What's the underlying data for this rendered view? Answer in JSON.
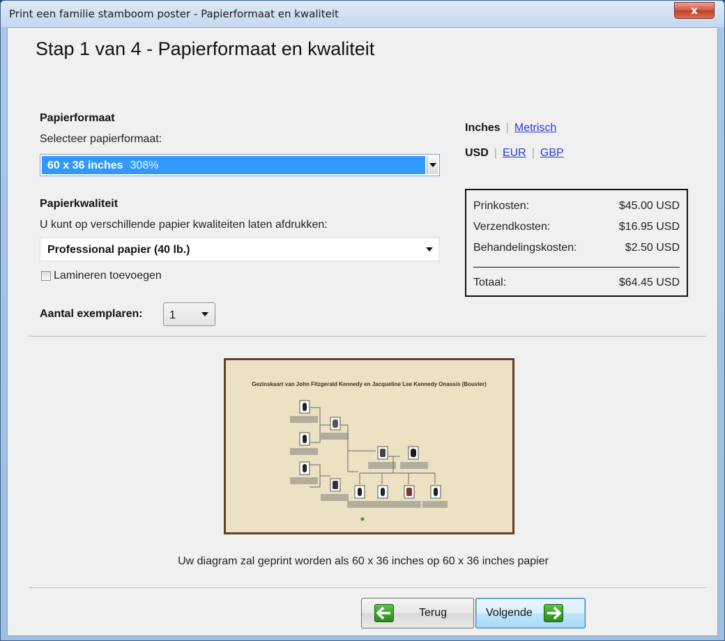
{
  "window": {
    "title": "Print een familie stamboom poster - Papierformaat en kwaliteit",
    "close_label": "x"
  },
  "step_heading": "Stap 1 van 4 - Papierformaat en kwaliteit",
  "paper_size": {
    "section_label": "Papierformaat",
    "prompt": "Selecteer papierformaat:",
    "selected_value": "60 x 36 inches",
    "selected_percent": "308%"
  },
  "paper_quality": {
    "section_label": "Papierkwaliteit",
    "prompt": "U kunt op verschillende papier kwaliteiten laten afdrukken:",
    "selected_value": "Professional papier (40 lb.)",
    "laminate_label": "Lamineren toevoegen",
    "laminate_checked": false
  },
  "copies": {
    "label": "Aantal exemplaren:",
    "value": "1"
  },
  "units": {
    "length_active": "Inches",
    "length_other": "Metrisch",
    "currency_active": "USD",
    "currency_options": [
      "EUR",
      "GBP"
    ]
  },
  "costs": {
    "rows": [
      {
        "label": "Prinkosten:",
        "value": "$45.00 USD"
      },
      {
        "label": "Verzendkosten:",
        "value": "$16.95 USD"
      },
      {
        "label": "Behandelingskosten:",
        "value": "$2.50 USD"
      }
    ],
    "total_label": "Totaal:",
    "total_value": "$64.45 USD"
  },
  "preview": {
    "title": "Gezinskaart van John Fitzgerald Kennedy en Jacqueline Lee Kennedy Onassis (Bouvier)"
  },
  "caption": "Uw diagram zal geprint worden als 60 x 36 inches op 60 x 36 inches papier",
  "buttons": {
    "back": "Terug",
    "next": "Volgende"
  },
  "colors": {
    "selection": "#3399ff",
    "link": "#2a3bd6",
    "arrow_green": "#3aa02a",
    "poster_bg": "#ece1c2",
    "poster_frame": "#5e3f2b"
  }
}
